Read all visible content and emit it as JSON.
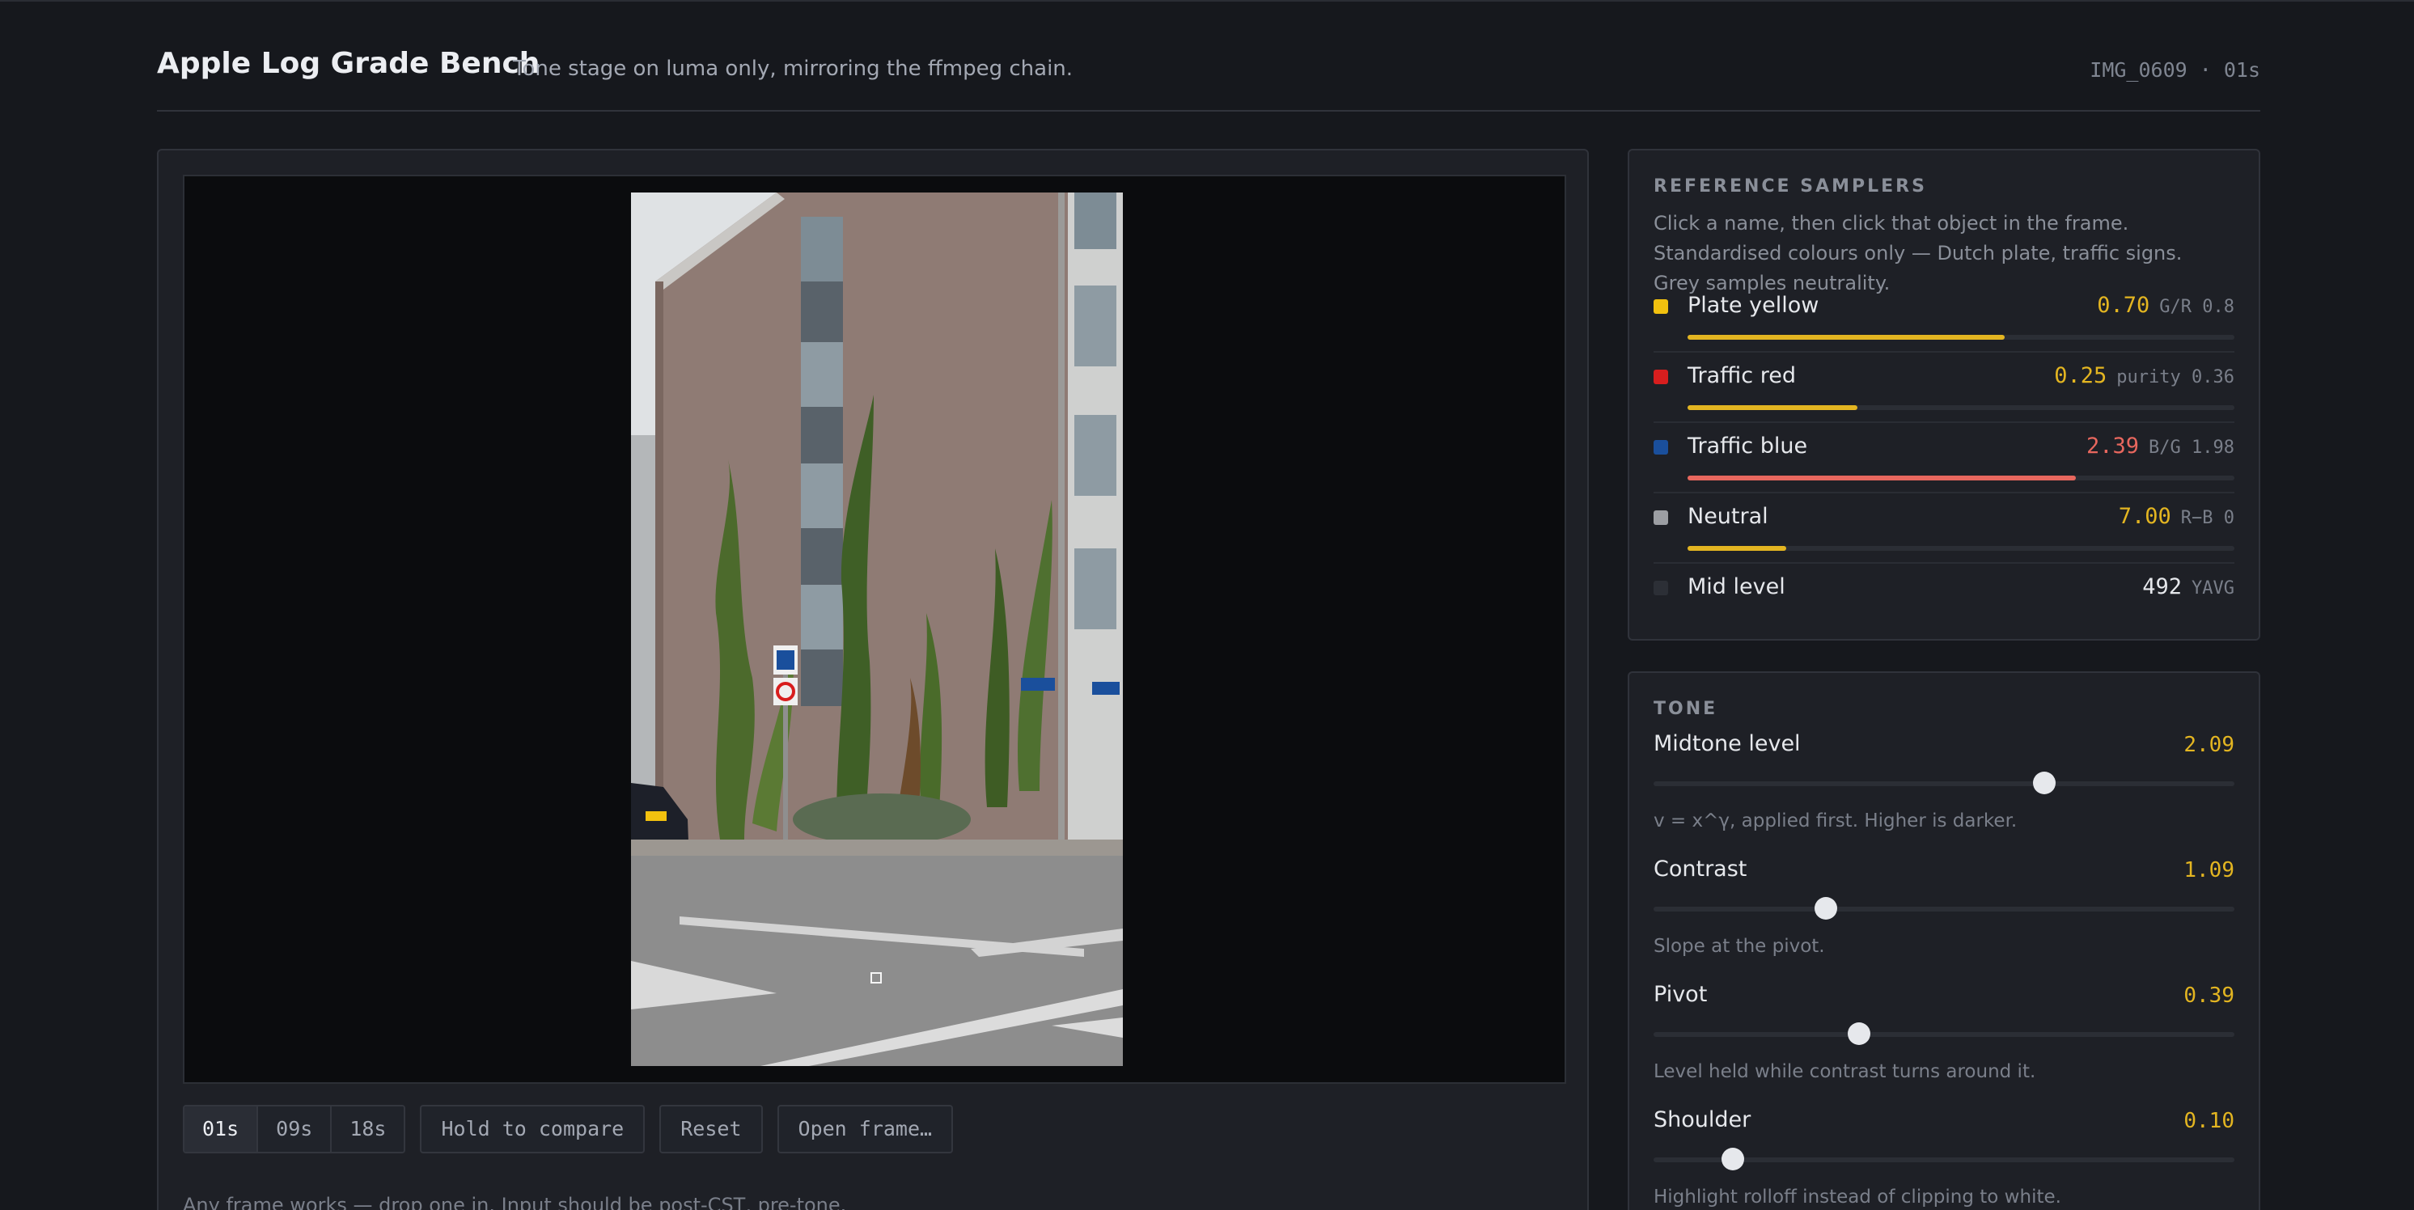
{
  "header": {
    "title": "Apple Log Grade Bench",
    "subtitle": "Tone stage on luma only, mirroring the ffmpeg chain.",
    "file_info": "IMG_0609 · 01s"
  },
  "viewer": {
    "frame_buttons": [
      {
        "label": "01s",
        "active": true
      },
      {
        "label": "09s",
        "active": false
      },
      {
        "label": "18s",
        "active": false
      }
    ],
    "compare_label": "Hold to compare",
    "reset_label": "Reset",
    "open_label": "Open frame…",
    "footnote": "Any frame works — drop one in. Input should be post-CST, pre-tone."
  },
  "samplers": {
    "heading": "REFERENCE SAMPLERS",
    "description": "Click a name, then click that object in the frame. Standardised colours only — Dutch plate, traffic signs. Grey samples neutrality.",
    "items": [
      {
        "name": "Plate yellow",
        "value": "0.70",
        "meta": "G/R 0.8",
        "swatch": "#f2c10f",
        "value_color": "#e3b521",
        "bar_color": "#e3b521",
        "bar_fraction": 0.58
      },
      {
        "name": "Traffic red",
        "value": "0.25",
        "meta": "purity 0.36",
        "swatch": "#d81e1e",
        "value_color": "#e3b521",
        "bar_color": "#e3b521",
        "bar_fraction": 0.31
      },
      {
        "name": "Traffic blue",
        "value": "2.39",
        "meta": "B/G 1.98",
        "swatch": "#1a4f9c",
        "value_color": "#e8675e",
        "bar_color": "#e8675e",
        "bar_fraction": 0.71
      },
      {
        "name": "Neutral",
        "value": "7.00",
        "meta": "R−B 0",
        "swatch": "#9c9ea3",
        "value_color": "#e3b521",
        "bar_color": "#e3b521",
        "bar_fraction": 0.18
      },
      {
        "name": "Mid level",
        "value": "492",
        "meta": "YAVG",
        "swatch": "#2c2f36",
        "value_color": "#e6e8ec",
        "bar_color": "",
        "bar_fraction": 0
      }
    ]
  },
  "tone": {
    "heading": "TONE",
    "sliders": [
      {
        "label": "Midtone level",
        "value": "2.09",
        "help": "v = x^γ, applied first. Higher is darker.",
        "fraction": 0.673
      },
      {
        "label": "Contrast",
        "value": "1.09",
        "help": "Slope at the pivot.",
        "fraction": 0.297
      },
      {
        "label": "Pivot",
        "value": "0.39",
        "help": "Level held while contrast turns around it.",
        "fraction": 0.354
      },
      {
        "label": "Shoulder",
        "value": "0.10",
        "help": "Highlight rolloff instead of clipping to white.",
        "fraction": 0.137
      }
    ]
  }
}
